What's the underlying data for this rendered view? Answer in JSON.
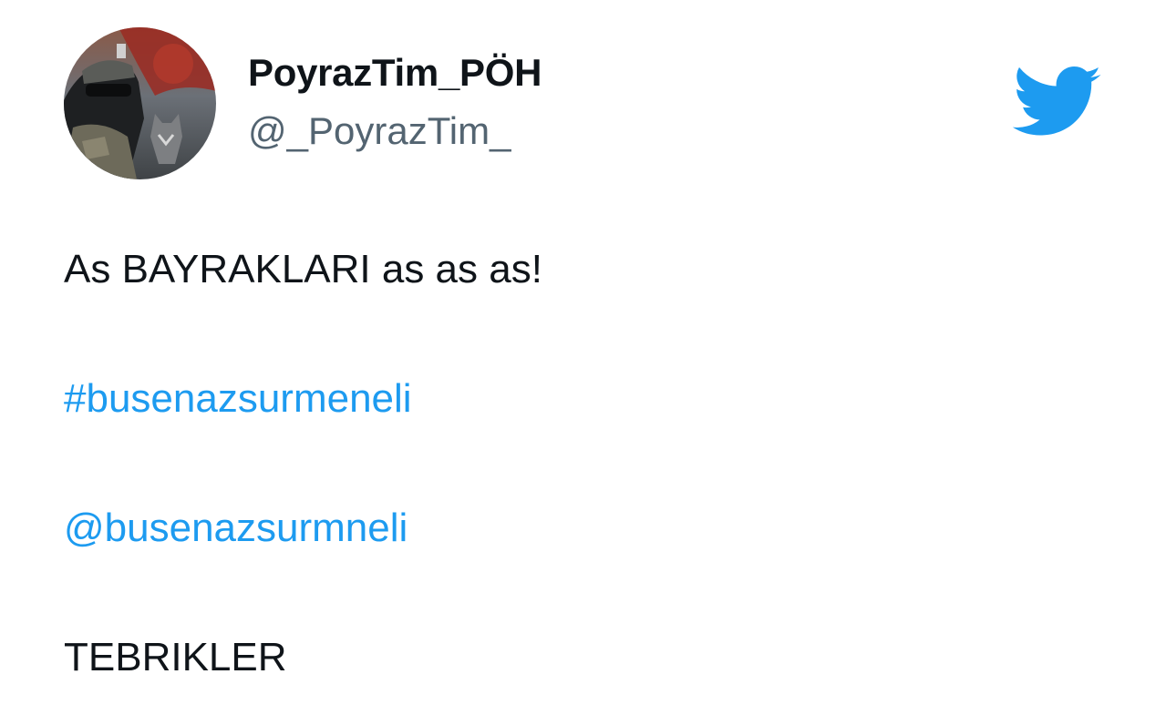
{
  "tweet": {
    "author": {
      "display_name": "PoyrazTim_PÖH",
      "handle": "@_PoyrazTim_"
    },
    "lines": [
      "As BAYRAKLARI as as as!",
      "#busenazsurmeneli",
      "@busenazsurmneli",
      "TEBRIKLER"
    ]
  },
  "icons": {
    "brand": "twitter-bird-icon",
    "avatar": "profile-avatar"
  },
  "colors": {
    "brand": "#1d9bf0",
    "link": "#1d9bf0",
    "text": "#0f1419",
    "secondary_text": "#536471"
  }
}
